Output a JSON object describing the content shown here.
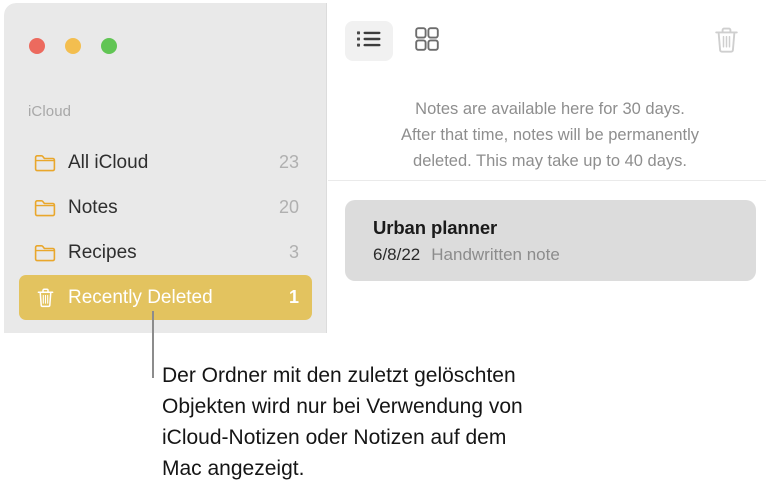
{
  "window": {
    "traffic_lights": [
      {
        "name": "close",
        "color": "#ec6a5e"
      },
      {
        "name": "minimize",
        "color": "#f3be4f"
      },
      {
        "name": "maximize",
        "color": "#61c554"
      }
    ]
  },
  "sidebar": {
    "section_title": "iCloud",
    "items": [
      {
        "icon": "folder-icon",
        "label": "All iCloud",
        "count": "23",
        "selected": false
      },
      {
        "icon": "folder-icon",
        "label": "Notes",
        "count": "20",
        "selected": false
      },
      {
        "icon": "folder-icon",
        "label": "Recipes",
        "count": "3",
        "selected": false
      },
      {
        "icon": "trash-icon",
        "label": "Recently Deleted",
        "count": "1",
        "selected": true
      }
    ],
    "selected_color": "#e3c35f",
    "folder_icon_color": "#e9a72c"
  },
  "toolbar": {
    "list_view_label": "list-view-icon",
    "grid_view_label": "grid-view-icon",
    "delete_label": "trash-icon",
    "list_view_active": true,
    "delete_disabled": true
  },
  "main": {
    "info_lines": [
      "Notes are available here for 30 days.",
      "After that time, notes will be permanently",
      "deleted. This may take up to 40 days."
    ],
    "notes": [
      {
        "title": "Urban planner",
        "date": "6/8/22",
        "subtitle": "Handwritten note"
      }
    ]
  },
  "caption": {
    "lines": [
      "Der Ordner mit den zuletzt gelöschten",
      "Objekten wird nur bei Verwendung von",
      "iCloud-Notizen oder Notizen auf dem",
      "Mac angezeigt."
    ]
  }
}
